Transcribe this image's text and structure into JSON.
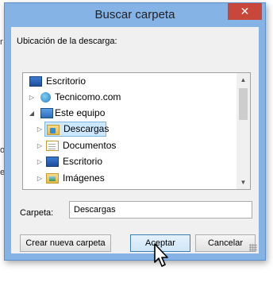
{
  "background_fragments": [
    "r",
    "o",
    "e"
  ],
  "dialog": {
    "title": "Buscar carpeta",
    "close_symbol": "✕",
    "prompt": "Ubicación de la descarga:",
    "tree": [
      {
        "label": "Escritorio",
        "icon": "desktop-icon",
        "expander": "",
        "selected": false
      },
      {
        "label": "Tecnicomo.com",
        "icon": "globe-icon",
        "expander": "▷",
        "selected": false
      },
      {
        "label": "Este equipo",
        "icon": "computer-icon",
        "expander": "◢",
        "selected": false
      },
      {
        "label": "Descargas",
        "icon": "downloads-folder-icon",
        "expander": "▷",
        "selected": true
      },
      {
        "label": "Documentos",
        "icon": "documents-folder-icon",
        "expander": "▷",
        "selected": false
      },
      {
        "label": "Escritorio",
        "icon": "desktop-folder-icon",
        "expander": "▷",
        "selected": false
      },
      {
        "label": "Imágenes",
        "icon": "pictures-folder-icon",
        "expander": "▷",
        "selected": false
      }
    ],
    "scroll_up": "▲",
    "scroll_down": "▼",
    "folder_label": "Carpeta:",
    "folder_value": "Descargas",
    "buttons": {
      "new_folder": "Crear nueva carpeta",
      "accept": "Aceptar",
      "cancel": "Cancelar"
    }
  },
  "colors": {
    "frame": "#85b3e6",
    "close": "#c8473a",
    "selection": "#cce8ff"
  }
}
